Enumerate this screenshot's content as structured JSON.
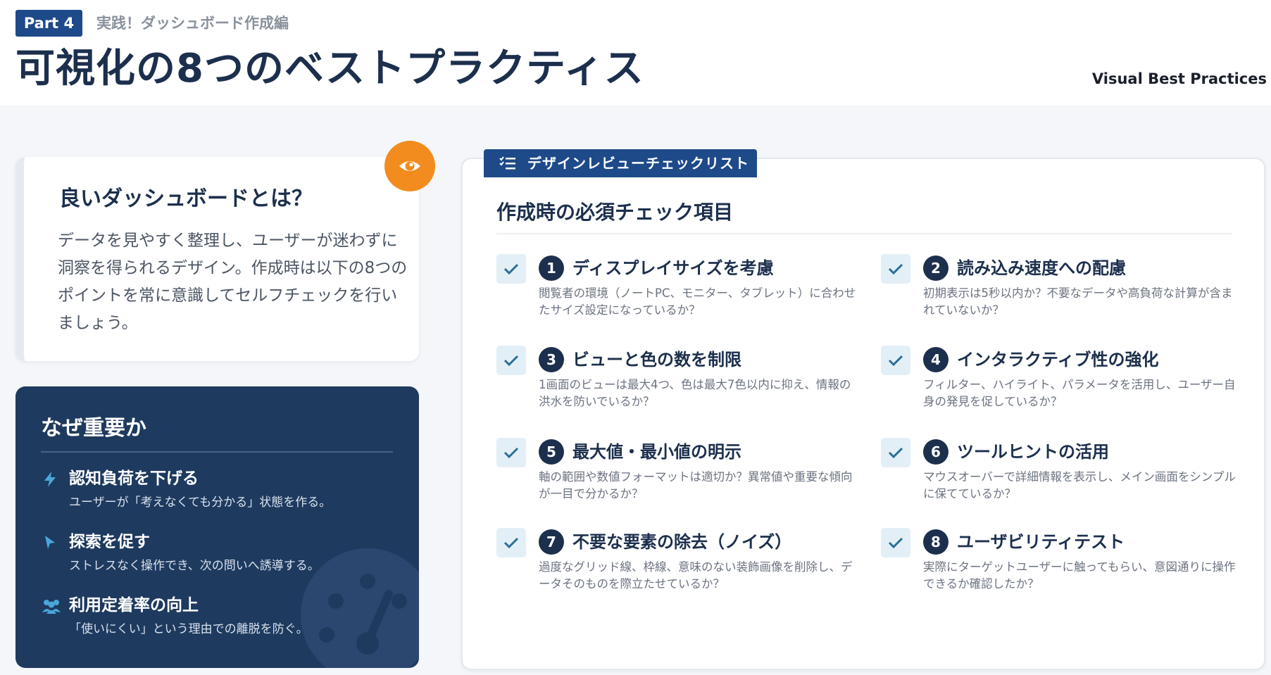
{
  "header": {
    "part_badge": "Part 4",
    "subtitle": "実践！ダッシュボード作成編",
    "title": "可視化の8つのベストプラクティス",
    "english_title": "Visual Best Practices"
  },
  "intro": {
    "title": "良いダッシュボードとは？",
    "body": "データを見やすく整理し、ユーザーが迷わずに洞察を得られるデザイン。作成時は以下の8つのポイントを常に意識してセルフチェックを行いましょう。",
    "icon": "eye-icon"
  },
  "why": {
    "title": "なぜ重要か",
    "items": [
      {
        "icon": "lightning-icon",
        "head": "認知負荷を下げる",
        "sub": "ユーザーが「考えなくても分かる」状態を作る。"
      },
      {
        "icon": "cursor-icon",
        "head": "探索を促す",
        "sub": "ストレスなく操作でき、次の問いへ誘導する。"
      },
      {
        "icon": "users-icon",
        "head": "利用定着率の向上",
        "sub": "「使いにくい」という理由での離脱を防ぐ。"
      }
    ]
  },
  "checklist": {
    "tab_label": "デザインレビューチェックリスト",
    "heading": "作成時の必須チェック項目",
    "items": [
      {
        "num": "1",
        "title": "ディスプレイサイズを考慮",
        "desc": "閲覧者の環境（ノートPC、モニター、タブレット）に合わせたサイズ設定になっているか？"
      },
      {
        "num": "2",
        "title": "読み込み速度への配慮",
        "desc": "初期表示は5秒以内か？不要なデータや高負荷な計算が含まれていないか？"
      },
      {
        "num": "3",
        "title": "ビューと色の数を制限",
        "desc": "1画面のビューは最大4つ、色は最大7色以内に抑え、情報の洪水を防いでいるか？"
      },
      {
        "num": "4",
        "title": "インタラクティブ性の強化",
        "desc": "フィルター、ハイライト、パラメータを活用し、ユーザー自身の発見を促しているか？"
      },
      {
        "num": "5",
        "title": "最大値・最小値の明示",
        "desc": "軸の範囲や数値フォーマットは適切か？異常値や重要な傾向が一目で分かるか？"
      },
      {
        "num": "6",
        "title": "ツールヒントの活用",
        "desc": "マウスオーバーで詳細情報を表示し、メイン画面をシンプルに保てているか？"
      },
      {
        "num": "7",
        "title": "不要な要素の除去（ノイズ）",
        "desc": "過度なグリッド線、枠線、意味のない装飾画像を削除し、データそのものを際立たせているか？"
      },
      {
        "num": "8",
        "title": "ユーザビリティテスト",
        "desc": "実際にターゲットユーザーに触ってもらい、意図通りに操作できるか確認したか？"
      }
    ]
  },
  "colors": {
    "navy": "#1e3a5f",
    "accent_blue": "#1e4a8a",
    "orange": "#f28c1e",
    "check_bg": "#e3eff6",
    "check_mark": "#2a6f97"
  }
}
